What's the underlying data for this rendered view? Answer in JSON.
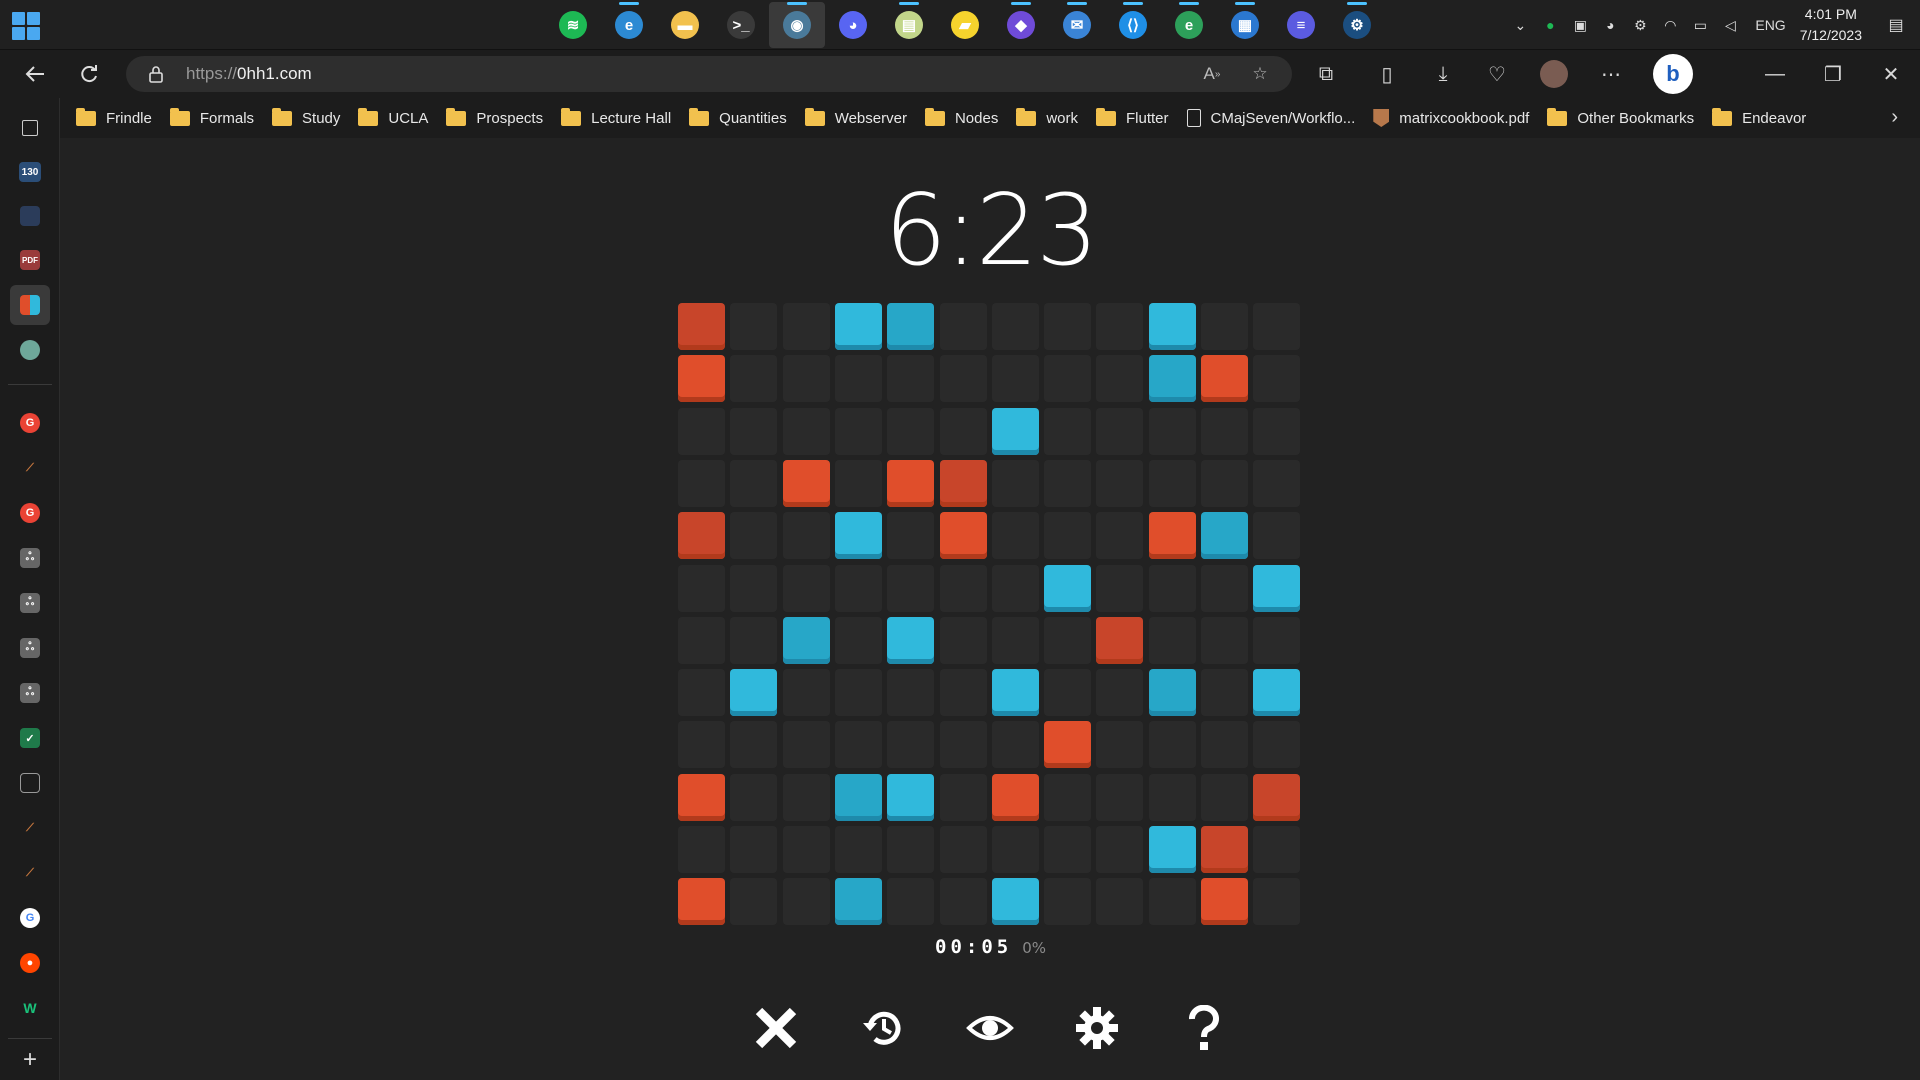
{
  "taskbar": {
    "apps": [
      {
        "name": "spotify",
        "color": "#1db954",
        "glyph": "≋"
      },
      {
        "name": "edge-beta",
        "color": "#2c8ad3",
        "glyph": "e"
      },
      {
        "name": "file-explorer",
        "color": "#f2c14e",
        "glyph": "▬"
      },
      {
        "name": "terminal",
        "color": "#3a3a3a",
        "glyph": ">_"
      },
      {
        "name": "edge-profile",
        "color": "#4a7a9a",
        "glyph": "◉"
      },
      {
        "name": "discord",
        "color": "#5865f2",
        "glyph": "◕"
      },
      {
        "name": "matlab-notes",
        "color": "#c2d68a",
        "glyph": "▤"
      },
      {
        "name": "sticky-notes",
        "color": "#f6d32d",
        "glyph": "▰"
      },
      {
        "name": "obsidian",
        "color": "#6f4bd8",
        "glyph": "◆"
      },
      {
        "name": "outlook",
        "color": "#3a84d6",
        "glyph": "✉"
      },
      {
        "name": "vscode",
        "color": "#1f8fe6",
        "glyph": "⟨⟩"
      },
      {
        "name": "edge-canary",
        "color": "#2da05a",
        "glyph": "e"
      },
      {
        "name": "word-app",
        "color": "#2b78d0",
        "glyph": "▦"
      },
      {
        "name": "menu-app",
        "color": "#5b5be0",
        "glyph": "≡"
      },
      {
        "name": "steam",
        "color": "#1b4e80",
        "glyph": "⚙"
      }
    ],
    "tray": {
      "language": "ENG",
      "time": "4:01 PM",
      "date": "7/12/2023"
    }
  },
  "browser": {
    "url_prefix": "https://",
    "url_host": "0hh1.com",
    "favorites": [
      {
        "label": "Frindle",
        "type": "folder"
      },
      {
        "label": "Formals",
        "type": "folder"
      },
      {
        "label": "Study",
        "type": "folder"
      },
      {
        "label": "UCLA",
        "type": "folder"
      },
      {
        "label": "Prospects",
        "type": "folder"
      },
      {
        "label": "Lecture Hall",
        "type": "folder"
      },
      {
        "label": "Quantities",
        "type": "folder"
      },
      {
        "label": "Webserver",
        "type": "folder"
      },
      {
        "label": "Nodes",
        "type": "folder"
      },
      {
        "label": "work",
        "type": "folder"
      },
      {
        "label": "Flutter",
        "type": "folder"
      },
      {
        "label": "CMajSeven/Workflo...",
        "type": "doc"
      },
      {
        "label": "matrixcookbook.pdf",
        "type": "pdf"
      },
      {
        "label": "Other Bookmarks",
        "type": "folder"
      },
      {
        "label": "Endeavor",
        "type": "folder"
      }
    ],
    "sidebar_tab_badge": "130"
  },
  "game": {
    "timer": "6:23",
    "elapsed": "00:05",
    "progress": "0%",
    "colors": {
      "red": "#e04e2b",
      "blue": "#30b9dc",
      "empty": "#2a2a2a"
    },
    "board": [
      [
        "R",
        "E",
        "E",
        "B",
        "B",
        "E",
        "E",
        "E",
        "E",
        "B",
        "E",
        "E"
      ],
      [
        "R",
        "E",
        "E",
        "E",
        "E",
        "E",
        "E",
        "E",
        "E",
        "B",
        "R",
        "E"
      ],
      [
        "E",
        "E",
        "E",
        "E",
        "E",
        "E",
        "B",
        "E",
        "E",
        "E",
        "E",
        "E"
      ],
      [
        "E",
        "E",
        "R",
        "E",
        "R",
        "R",
        "E",
        "E",
        "E",
        "E",
        "E",
        "E"
      ],
      [
        "R",
        "E",
        "E",
        "B",
        "E",
        "R",
        "E",
        "E",
        "E",
        "R",
        "B",
        "E"
      ],
      [
        "E",
        "E",
        "E",
        "E",
        "E",
        "E",
        "E",
        "B",
        "E",
        "E",
        "E",
        "B"
      ],
      [
        "E",
        "E",
        "B",
        "E",
        "B",
        "E",
        "E",
        "E",
        "R",
        "E",
        "E",
        "E"
      ],
      [
        "E",
        "B",
        "E",
        "E",
        "E",
        "E",
        "B",
        "E",
        "E",
        "B",
        "E",
        "B"
      ],
      [
        "E",
        "E",
        "E",
        "E",
        "E",
        "E",
        "E",
        "R",
        "E",
        "E",
        "E",
        "E"
      ],
      [
        "R",
        "E",
        "E",
        "B",
        "B",
        "E",
        "R",
        "E",
        "E",
        "E",
        "E",
        "R"
      ],
      [
        "E",
        "E",
        "E",
        "E",
        "E",
        "E",
        "E",
        "E",
        "E",
        "B",
        "R",
        "E"
      ],
      [
        "R",
        "E",
        "E",
        "B",
        "E",
        "E",
        "B",
        "E",
        "E",
        "E",
        "R",
        "E"
      ]
    ],
    "locked_dark": [
      [
        0,
        0
      ],
      [
        3,
        5
      ],
      [
        4,
        0
      ],
      [
        6,
        8
      ],
      [
        9,
        11
      ],
      [
        10,
        10
      ],
      [
        0,
        4
      ],
      [
        1,
        9
      ],
      [
        4,
        10
      ],
      [
        6,
        2
      ],
      [
        7,
        9
      ],
      [
        9,
        3
      ],
      [
        11,
        3
      ]
    ],
    "controls": [
      "close-icon",
      "history-icon",
      "eye-icon",
      "settings-icon",
      "help-icon"
    ]
  }
}
